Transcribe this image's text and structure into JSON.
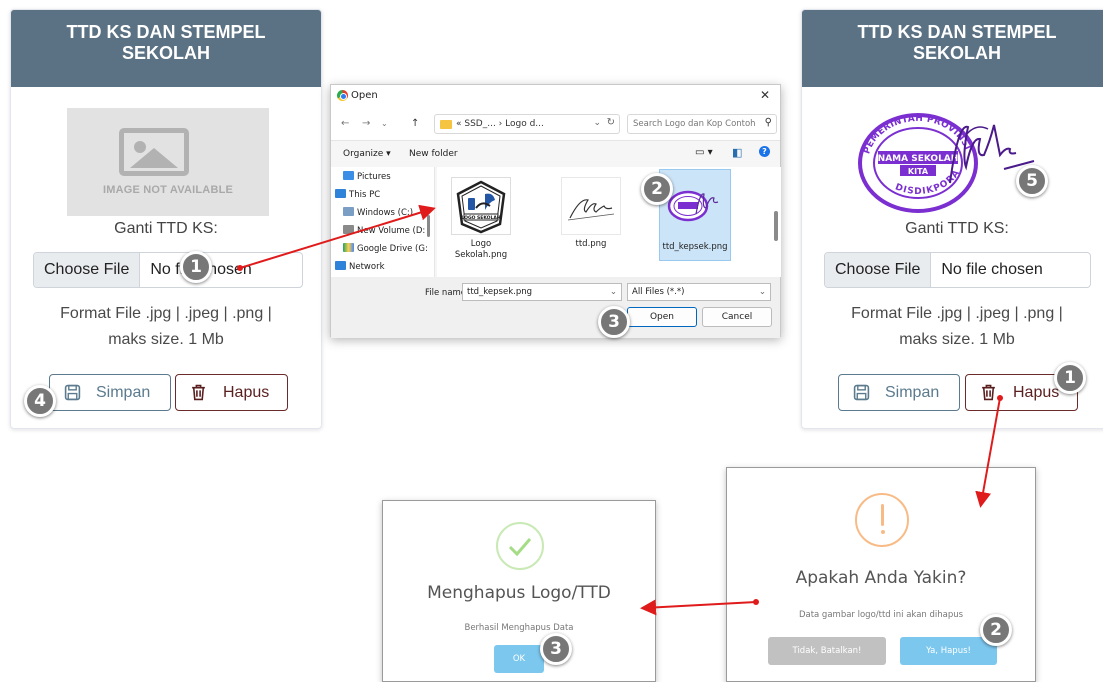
{
  "card_left": {
    "title_line1": "TTD KS DAN STEMPEL",
    "title_line2": "SEKOLAH",
    "placeholder_text": "IMAGE NOT AVAILABLE",
    "change_label": "Ganti TTD KS:",
    "choose_file": "Choose File",
    "no_file": "No file chosen",
    "format_line1": "Format File .jpg | .jpeg | .png |",
    "format_line2": "maks size. 1 Mb",
    "save_label": "Simpan",
    "delete_label": "Hapus"
  },
  "card_right": {
    "title_line1": "TTD KS DAN STEMPEL",
    "title_line2": "SEKOLAH",
    "stamp_top": "PEMERINTAH PROVINSI",
    "stamp_center1": "NAMA SEKOLAH",
    "stamp_center2": "KITA",
    "stamp_bottom": "DISDIKPORA",
    "change_label": "Ganti TTD KS:",
    "choose_file": "Choose File",
    "no_file": "No file chosen",
    "format_line1": "Format File .jpg | .jpeg | .png |",
    "format_line2": "maks size. 1 Mb",
    "save_label": "Simpan",
    "delete_label": "Hapus"
  },
  "open_dialog": {
    "title": "Open",
    "close": "✕",
    "path": "« SSD_... › Logo d...",
    "search_placeholder": "Search Logo dan Kop Contoh",
    "organize": "Organize ▾",
    "new_folder": "New folder",
    "nav_items": [
      "Pictures",
      "This PC",
      "Windows (C:)",
      "New Volume (D:",
      "Google Drive (G:",
      "Network"
    ],
    "files": [
      {
        "name_line1": "Logo",
        "name_line2": "Sekolah.png",
        "logo_text": "LOGO SEKOLAH"
      },
      {
        "name_line1": "ttd.png",
        "name_line2": ""
      },
      {
        "name_line1": "ttd_kepsek.png",
        "name_line2": ""
      }
    ],
    "file_name_label": "File name:",
    "file_name_value": "ttd_kepsek.png",
    "filter": "All Files (*.*)",
    "open_btn": "Open",
    "cancel_btn": "Cancel"
  },
  "confirm_dialog": {
    "title": "Apakah Anda Yakin?",
    "message": "Data gambar logo/ttd ini akan dihapus",
    "cancel": "Tidak, Batalkan!",
    "confirm": "Ya, Hapus!"
  },
  "success_dialog": {
    "title": "Menghapus Logo/TTD",
    "message": "Berhasil Menghapus Data",
    "ok": "OK"
  },
  "steps_left": [
    "1",
    "2",
    "3",
    "4",
    "5"
  ],
  "steps_right": [
    "1",
    "2",
    "3"
  ],
  "colors": {
    "card_header": "#5b7184",
    "arrow": "#e01b1b",
    "stamp": "#7b2fd0",
    "confirm_btn": "#7cc7ee",
    "cancel_btn": "#c1c1c1",
    "warning": "#f8bb86",
    "success": "#a5dc86"
  }
}
